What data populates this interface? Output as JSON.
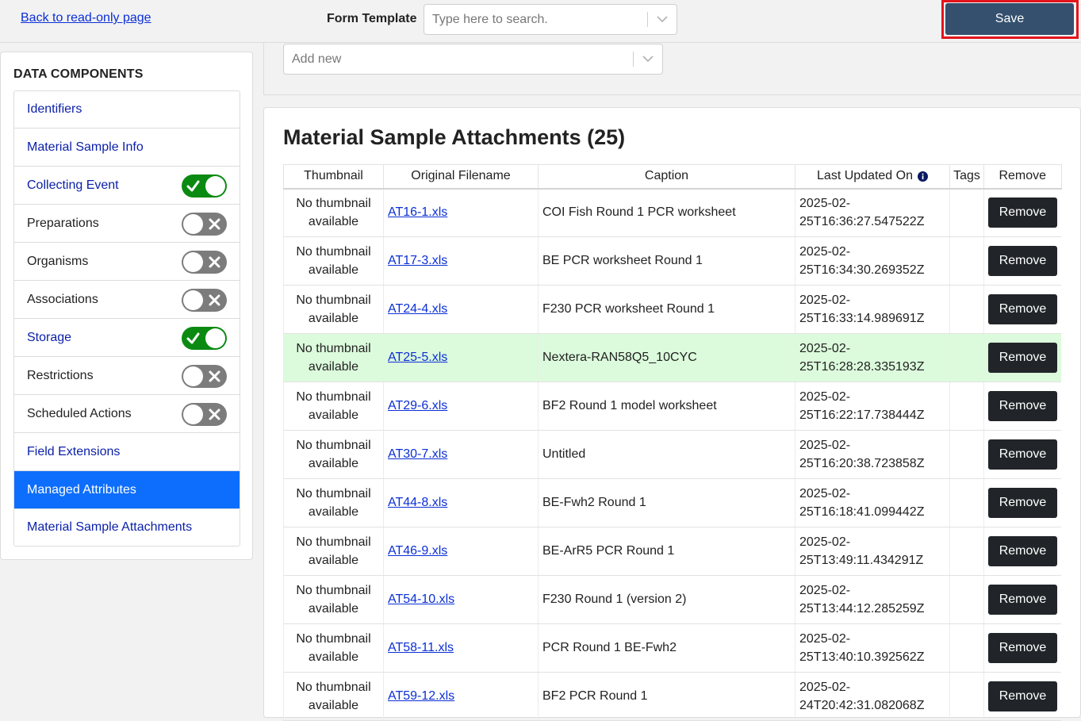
{
  "topbar": {
    "back_link": "Back to read-only page",
    "form_template_label": "Form Template",
    "form_template_placeholder": "Type here to search.",
    "save_label": "Save"
  },
  "sidebar": {
    "heading": "DATA COMPONENTS",
    "items": [
      {
        "label": "Identifiers",
        "toggle": null,
        "active": false
      },
      {
        "label": "Material Sample Info",
        "toggle": null,
        "active": false
      },
      {
        "label": "Collecting Event",
        "toggle": "on",
        "active": false
      },
      {
        "label": "Preparations",
        "toggle": "off",
        "active": false
      },
      {
        "label": "Organisms",
        "toggle": "off",
        "active": false
      },
      {
        "label": "Associations",
        "toggle": "off",
        "active": false
      },
      {
        "label": "Storage",
        "toggle": "on",
        "active": false
      },
      {
        "label": "Restrictions",
        "toggle": "off",
        "active": false
      },
      {
        "label": "Scheduled Actions",
        "toggle": "off",
        "active": false
      },
      {
        "label": "Field Extensions",
        "toggle": null,
        "active": false
      },
      {
        "label": "Managed Attributes",
        "toggle": null,
        "active": true
      },
      {
        "label": "Material Sample Attachments",
        "toggle": null,
        "active": false
      }
    ]
  },
  "add_new": {
    "placeholder": "Add new"
  },
  "attachments": {
    "title": "Material Sample Attachments (25)",
    "columns": [
      "Thumbnail",
      "Original Filename",
      "Caption",
      "Last Updated On",
      "Tags",
      "Remove"
    ],
    "rows": [
      {
        "thumb": [
          "No thumbnail",
          "available"
        ],
        "filename": "AT16-1.xls",
        "caption": "COI Fish Round 1 PCR worksheet",
        "updated": [
          "2025-02-",
          "25T16:36:27.547522Z"
        ],
        "tags": "",
        "remove": "Remove",
        "highlight": false
      },
      {
        "thumb": [
          "No thumbnail",
          "available"
        ],
        "filename": "AT17-3.xls",
        "caption": "BE PCR worksheet Round 1",
        "updated": [
          "2025-02-",
          "25T16:34:30.269352Z"
        ],
        "tags": "",
        "remove": "Remove",
        "highlight": false
      },
      {
        "thumb": [
          "No thumbnail",
          "available"
        ],
        "filename": "AT24-4.xls",
        "caption": "F230 PCR worksheet Round 1",
        "updated": [
          "2025-02-",
          "25T16:33:14.989691Z"
        ],
        "tags": "",
        "remove": "Remove",
        "highlight": false
      },
      {
        "thumb": [
          "No thumbnail",
          "available"
        ],
        "filename": "AT25-5.xls",
        "caption": "Nextera-RAN58Q5_10CYC",
        "updated": [
          "2025-02-",
          "25T16:28:28.335193Z"
        ],
        "tags": "",
        "remove": "Remove",
        "highlight": true
      },
      {
        "thumb": [
          "No thumbnail",
          "available"
        ],
        "filename": "AT29-6.xls",
        "caption": "BF2 Round 1 model worksheet",
        "updated": [
          "2025-02-",
          "25T16:22:17.738444Z"
        ],
        "tags": "",
        "remove": "Remove",
        "highlight": false
      },
      {
        "thumb": [
          "No thumbnail",
          "available"
        ],
        "filename": "AT30-7.xls",
        "caption": "Untitled",
        "updated": [
          "2025-02-",
          "25T16:20:38.723858Z"
        ],
        "tags": "",
        "remove": "Remove",
        "highlight": false
      },
      {
        "thumb": [
          "No thumbnail",
          "available"
        ],
        "filename": "AT44-8.xls",
        "caption": "BE-Fwh2 Round 1",
        "updated": [
          "2025-02-",
          "25T16:18:41.099442Z"
        ],
        "tags": "",
        "remove": "Remove",
        "highlight": false
      },
      {
        "thumb": [
          "No thumbnail",
          "available"
        ],
        "filename": "AT46-9.xls",
        "caption": "BE-ArR5 PCR Round 1",
        "updated": [
          "2025-02-",
          "25T13:49:11.434291Z"
        ],
        "tags": "",
        "remove": "Remove",
        "highlight": false
      },
      {
        "thumb": [
          "No thumbnail",
          "available"
        ],
        "filename": "AT54-10.xls",
        "caption": "F230 Round 1 (version 2)",
        "updated": [
          "2025-02-",
          "25T13:44:12.285259Z"
        ],
        "tags": "",
        "remove": "Remove",
        "highlight": false
      },
      {
        "thumb": [
          "No thumbnail",
          "available"
        ],
        "filename": "AT58-11.xls",
        "caption": "PCR Round 1 BE-Fwh2",
        "updated": [
          "2025-02-",
          "25T13:40:10.392562Z"
        ],
        "tags": "",
        "remove": "Remove",
        "highlight": false
      },
      {
        "thumb": [
          "No thumbnail",
          "available"
        ],
        "filename": "AT59-12.xls",
        "caption": "BF2 PCR Round 1",
        "updated": [
          "2025-02-",
          "24T20:42:31.082068Z"
        ],
        "tags": "",
        "remove": "Remove",
        "highlight": false
      }
    ]
  },
  "colors": {
    "link": "#0b2fd6",
    "save_button": "#34506e",
    "save_highlight_border": "#e3141b",
    "toggle_on": "#0b8a12",
    "toggle_off": "#7c7c7c",
    "active_item": "#0d6efd",
    "row_highlight": "#dcfbdc",
    "remove_button": "#212529"
  },
  "icons": {
    "select_chevron": "chevron-down-icon",
    "toggle_on": "check-icon",
    "toggle_off": "x-icon",
    "last_updated_info": "info-icon"
  }
}
